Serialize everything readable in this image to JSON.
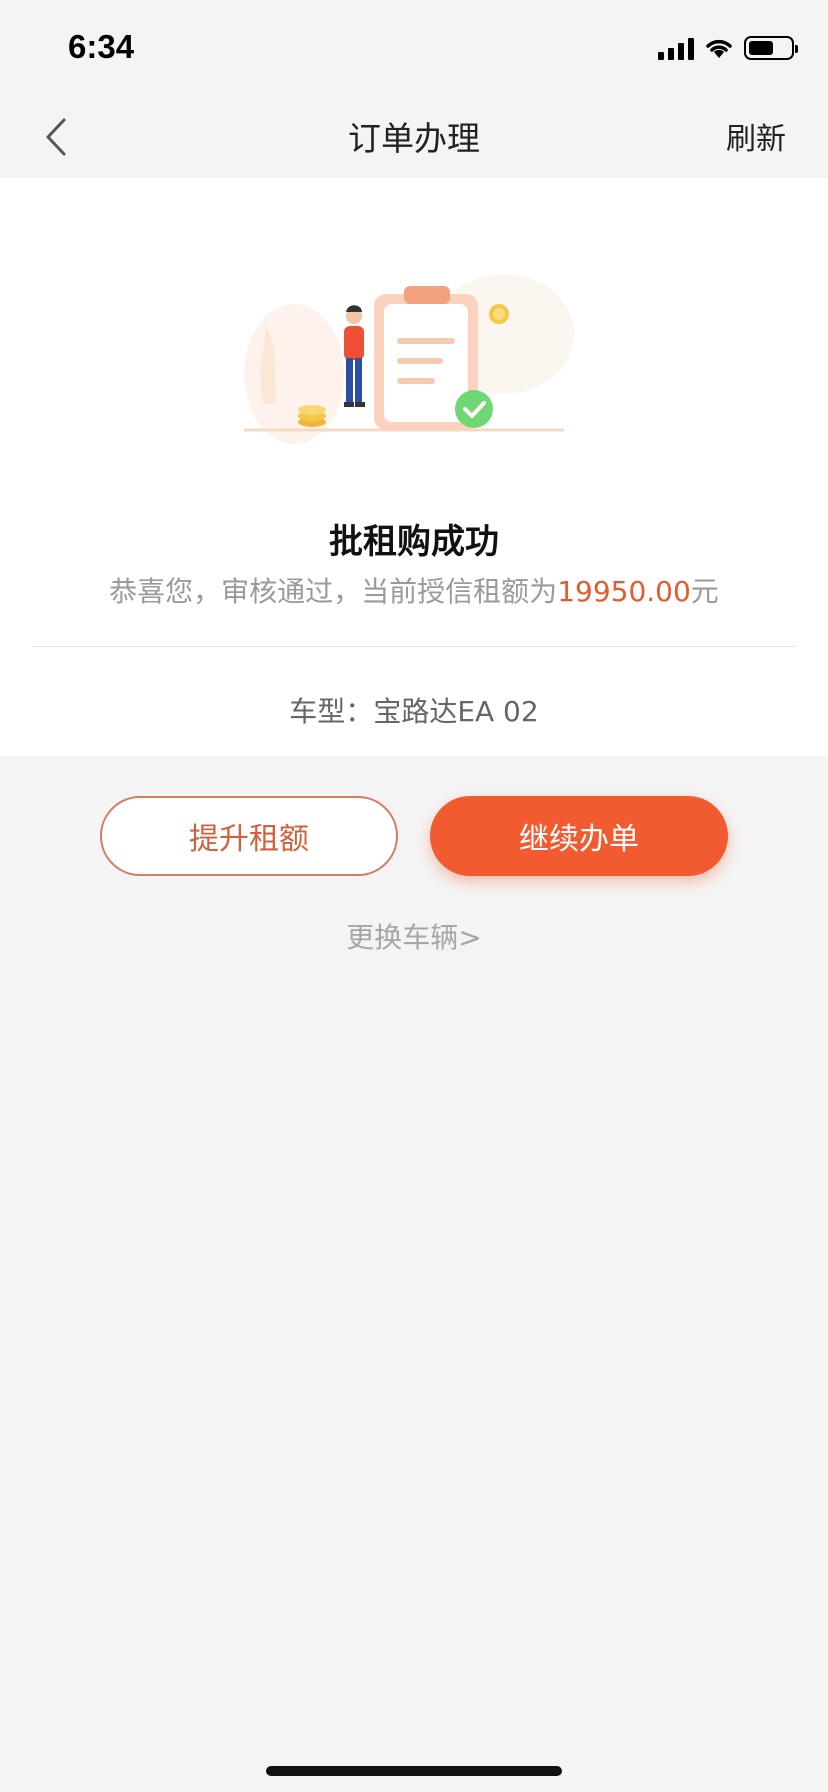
{
  "status_bar": {
    "time": "6:34"
  },
  "nav": {
    "title": "订单办理",
    "refresh_label": "刷新",
    "back_icon": "chevron-left-icon"
  },
  "result": {
    "title": "批租购成功",
    "desc_prefix": "恭喜您，审核通过，当前授信租额为",
    "amount": "19950.00",
    "desc_suffix": "元"
  },
  "car": {
    "label": "车型：",
    "model": "宝路达EA 02"
  },
  "buttons": {
    "raise_limit": "提升租额",
    "continue": "继续办单"
  },
  "change_vehicle": "更换车辆>",
  "colors": {
    "accent": "#f25a2f",
    "amount": "#e35c2f",
    "background": "#f4f4f4"
  }
}
